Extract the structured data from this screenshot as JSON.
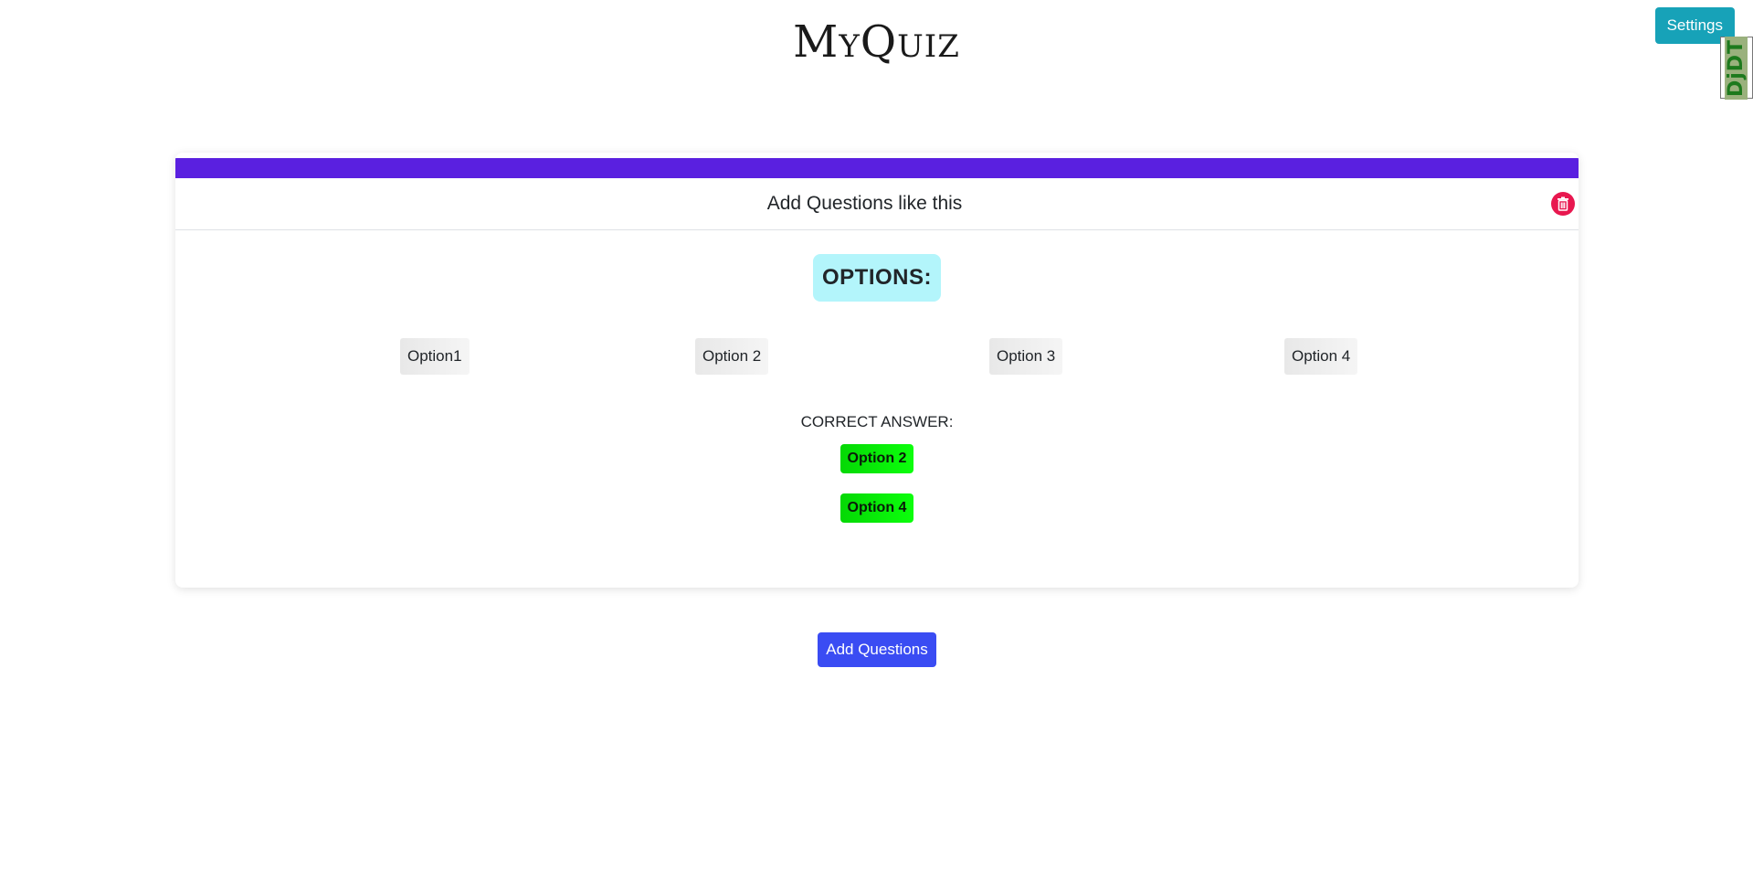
{
  "header": {
    "logo_text": "MyQuiz",
    "settings_label": "Settings",
    "debug_tab_label": "DjDT"
  },
  "question_card": {
    "question_text": "Add Questions like this",
    "options_heading": "OPTIONS:",
    "options": [
      "Option1",
      "Option 2",
      "Option 3",
      "Option 4"
    ],
    "correct_answer_label": "CORRECT ANSWER:",
    "correct_answers": [
      "Option 2",
      "Option 4"
    ]
  },
  "actions": {
    "add_questions_label": "Add Questions"
  },
  "colors": {
    "accent_bar": "#5a20e0",
    "settings_button": "#17a2b8",
    "add_button": "#3a4cf3",
    "delete_button": "#e8174f",
    "options_heading_bg": "#b3f5fb",
    "correct_answer_bg": "#0cff0c"
  },
  "icons": {
    "delete": "trash-icon"
  }
}
